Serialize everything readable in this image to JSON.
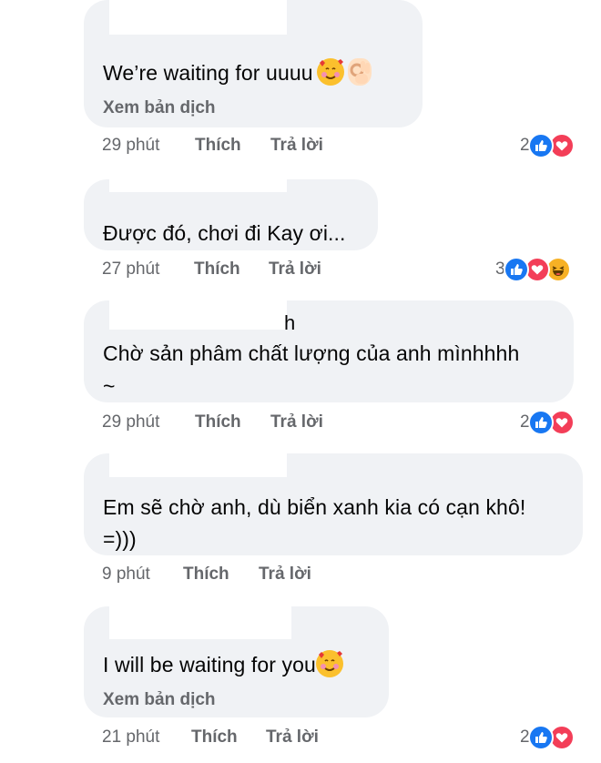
{
  "comments": [
    {
      "text": "We’re waiting for uuuu",
      "emojis": [
        "smiling-face-with-hearts-icon",
        "ok-hand-icon"
      ],
      "translate_label": "Xem bản dịch",
      "time": "29 phút",
      "like_label": "Thích",
      "reply_label": "Trả lời",
      "reaction_count": "2",
      "reactions": [
        "like-icon",
        "love-icon"
      ]
    },
    {
      "text": "Được đó, chơi đi Kay ơi...",
      "time": "27 phút",
      "like_label": "Thích",
      "reply_label": "Trả lời",
      "reaction_count": "3",
      "reactions": [
        "like-icon",
        "love-icon",
        "haha-icon"
      ]
    },
    {
      "name_fragment": "h",
      "text_line1": "Chờ sản phâm chất lượng của anh mìnhhhh",
      "text_line2": "~",
      "time": "29 phút",
      "like_label": "Thích",
      "reply_label": "Trả lời",
      "reaction_count": "2",
      "reactions": [
        "like-icon",
        "love-icon"
      ]
    },
    {
      "text_line1": "Em sẽ chờ anh, dù biển xanh kia có cạn khô!",
      "text_line2": "=)))",
      "time": "9 phút",
      "like_label": "Thích",
      "reply_label": "Trả lời"
    },
    {
      "text": "I will be waiting for you",
      "emojis": [
        "smiling-face-with-hearts-icon"
      ],
      "translate_label": "Xem bản dịch",
      "time": "21 phút",
      "like_label": "Thích",
      "reply_label": "Trả lời",
      "reaction_count": "2",
      "reactions": [
        "like-icon",
        "love-icon"
      ]
    }
  ],
  "colors": {
    "bubble": "#f0f2f5",
    "meta_text": "#65676b",
    "like_blue": "#1877f2",
    "love_red": "#f33e58",
    "haha_yellow": "#f7b125"
  }
}
